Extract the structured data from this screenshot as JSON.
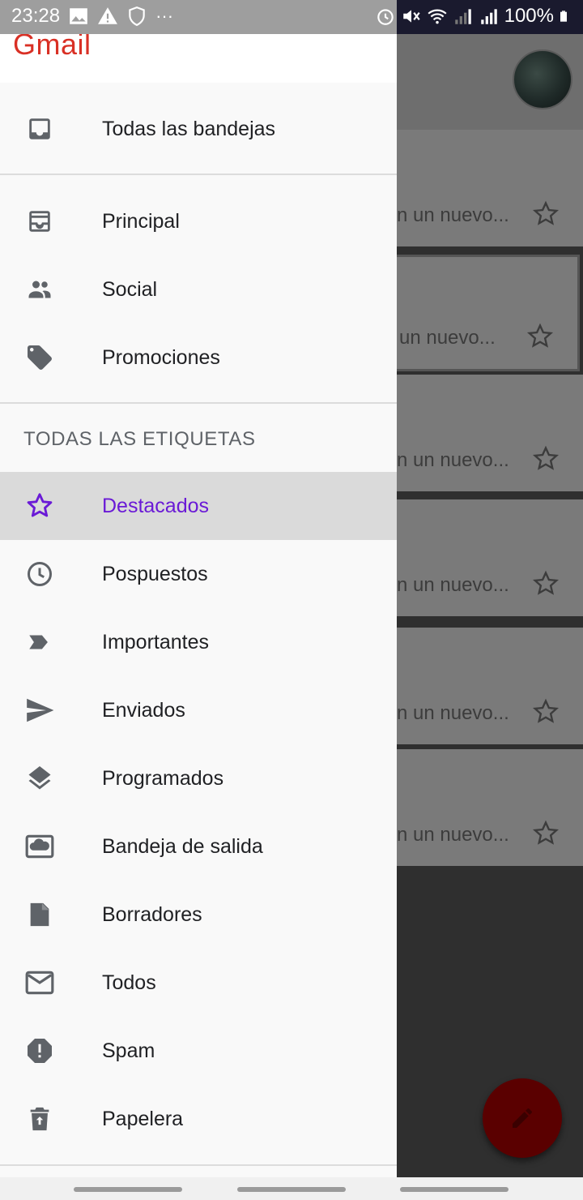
{
  "status_bar": {
    "time": "23:28",
    "battery": "100%",
    "icons": [
      "image-icon",
      "warning-icon",
      "shield-icon",
      "more-icon",
      "alarm-icon",
      "mute-icon",
      "wifi-icon",
      "signal-icon",
      "signal-icon",
      "battery-icon"
    ]
  },
  "drawer": {
    "logo": "Gmail",
    "top_item": {
      "label": "Todas las bandejas",
      "icon": "inbox-icon"
    },
    "categories": [
      {
        "label": "Principal",
        "icon": "primary-inbox-icon"
      },
      {
        "label": "Social",
        "icon": "people-icon"
      },
      {
        "label": "Promociones",
        "icon": "tag-icon"
      }
    ],
    "section_title": "TODAS LAS ETIQUETAS",
    "labels": [
      {
        "label": "Destacados",
        "icon": "star-icon",
        "selected": true
      },
      {
        "label": "Pospuestos",
        "icon": "clock-icon"
      },
      {
        "label": "Importantes",
        "icon": "important-icon"
      },
      {
        "label": "Enviados",
        "icon": "send-icon"
      },
      {
        "label": "Programados",
        "icon": "scheduled-icon"
      },
      {
        "label": "Bandeja de salida",
        "icon": "outbox-icon"
      },
      {
        "label": "Borradores",
        "icon": "draft-icon"
      },
      {
        "label": "Todos",
        "icon": "mail-icon"
      },
      {
        "label": "Spam",
        "icon": "spam-icon"
      },
      {
        "label": "Papelera",
        "icon": "trash-icon"
      }
    ],
    "selected_color": "#6a1ad6"
  },
  "inbox": {
    "snippets": [
      "n un nuevo...",
      "un nuevo...",
      "n un nuevo...",
      "n un nuevo...",
      "n un nuevo...",
      "n un nuevo..."
    ]
  }
}
